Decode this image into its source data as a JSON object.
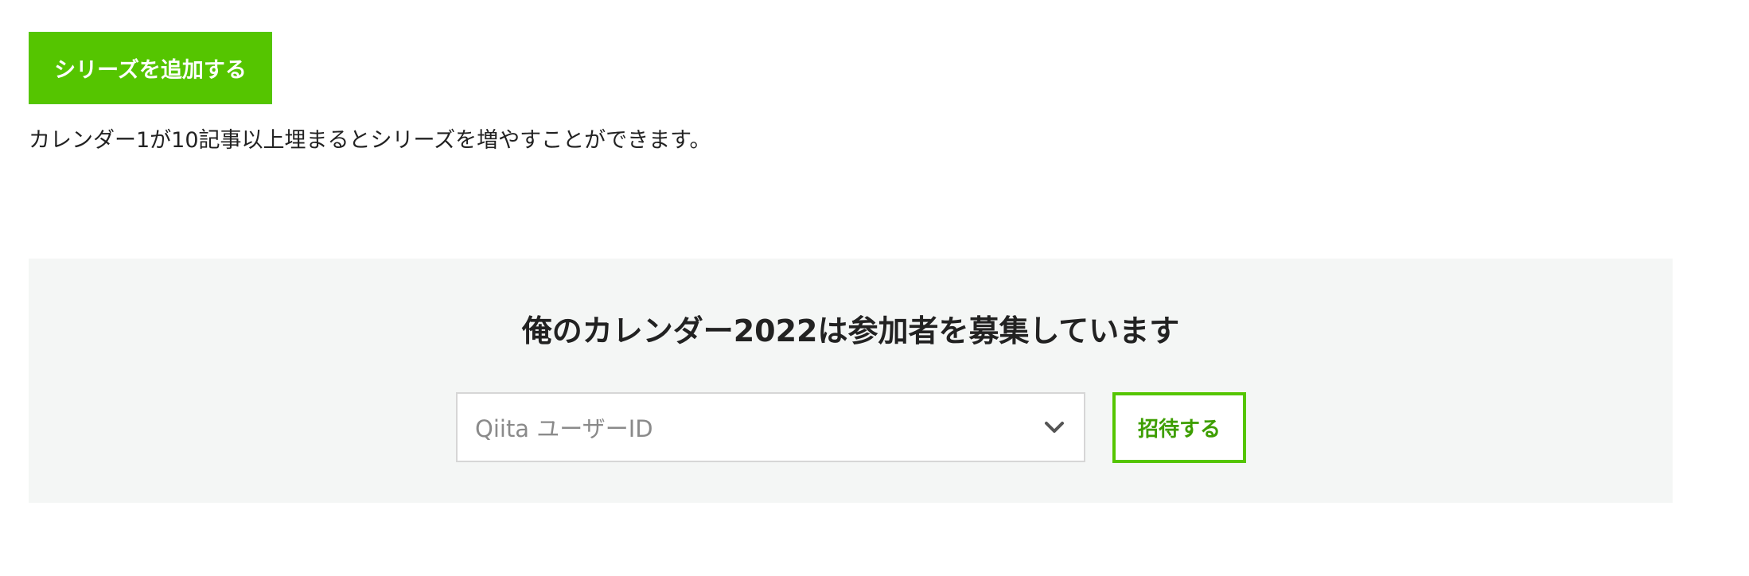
{
  "series": {
    "add_button_label": "シリーズを追加する",
    "note": "カレンダー1が10記事以上埋まるとシリーズを増やすことができます。"
  },
  "recruit": {
    "title": "俺のカレンダー2022は参加者を募集しています",
    "user_select": {
      "placeholder": "Qiita ユーザーID",
      "icon": "chevron-down-icon"
    },
    "invite_button_label": "招待する"
  },
  "colors": {
    "accent": "#55c500",
    "accent_text": "#3d9e00",
    "panel_background": "#f4f6f5"
  }
}
